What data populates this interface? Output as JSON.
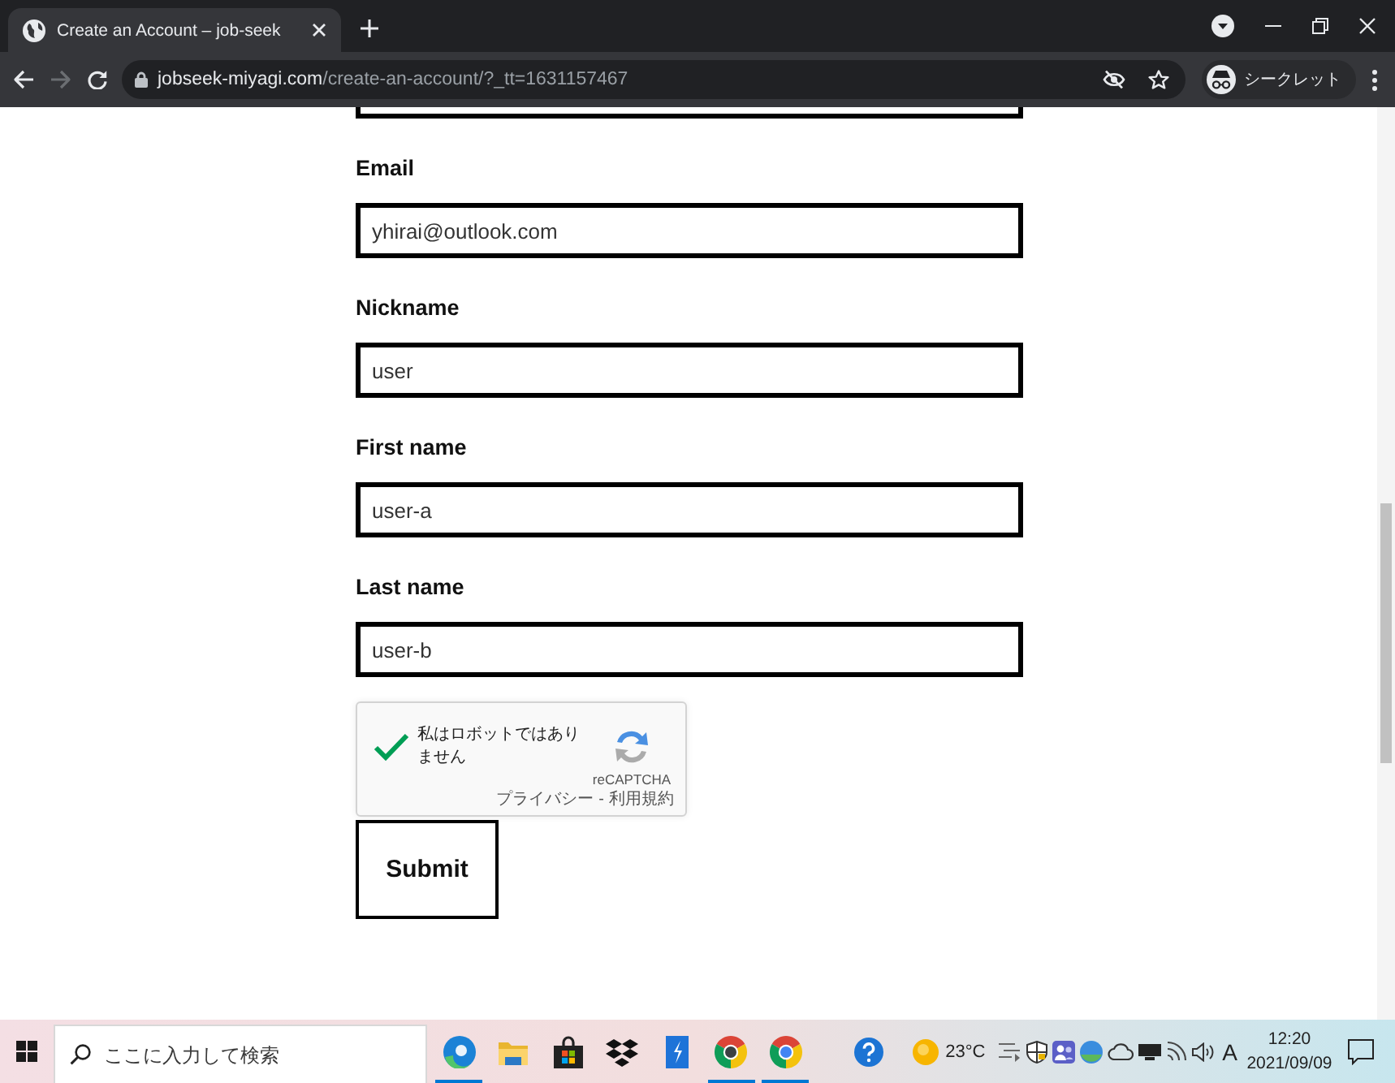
{
  "browser": {
    "tabs": [
      {
        "title": "Create an Account – job-seek",
        "selected": true
      }
    ],
    "nav": {
      "forward_disabled": true
    },
    "address_bar": {
      "domain": "jobseek-miyagi.com",
      "path": "/create-an-account/?_tt=1631157467"
    },
    "profile": {
      "label": "シークレット"
    }
  },
  "form": {
    "fields": [
      {
        "kind": "clipped"
      },
      {
        "kind": "text",
        "label": "Email",
        "value": "yhirai@outlook.com"
      },
      {
        "kind": "text",
        "label": "Nickname",
        "value": "user"
      },
      {
        "kind": "text",
        "label": "First name",
        "value": "user-a"
      },
      {
        "kind": "text",
        "label": "Last name",
        "value": "user-b"
      }
    ],
    "captcha": {
      "checked": true,
      "label": "私はロボットではありません",
      "brand": "reCAPTCHA",
      "links": [
        "プライバシー",
        "利用規約"
      ],
      "separator": "-"
    },
    "submit": {
      "label": "Submit"
    }
  },
  "taskbar": {
    "search": {
      "placeholder": "ここに入力して検索"
    },
    "apps": [
      {
        "kind": "swirl",
        "running": true
      },
      {
        "kind": "folder",
        "running": false
      },
      {
        "kind": "bag",
        "running": false
      },
      {
        "kind": "diamonds",
        "running": false
      },
      {
        "kind": "tile",
        "running": false
      },
      {
        "kind": "wheel-dark",
        "running": true
      },
      {
        "kind": "wheel",
        "running": true
      }
    ],
    "weather": {
      "temperature": "23°C"
    },
    "ime": "A",
    "clock": {
      "time": "12:20",
      "date": "2021/09/09"
    }
  }
}
